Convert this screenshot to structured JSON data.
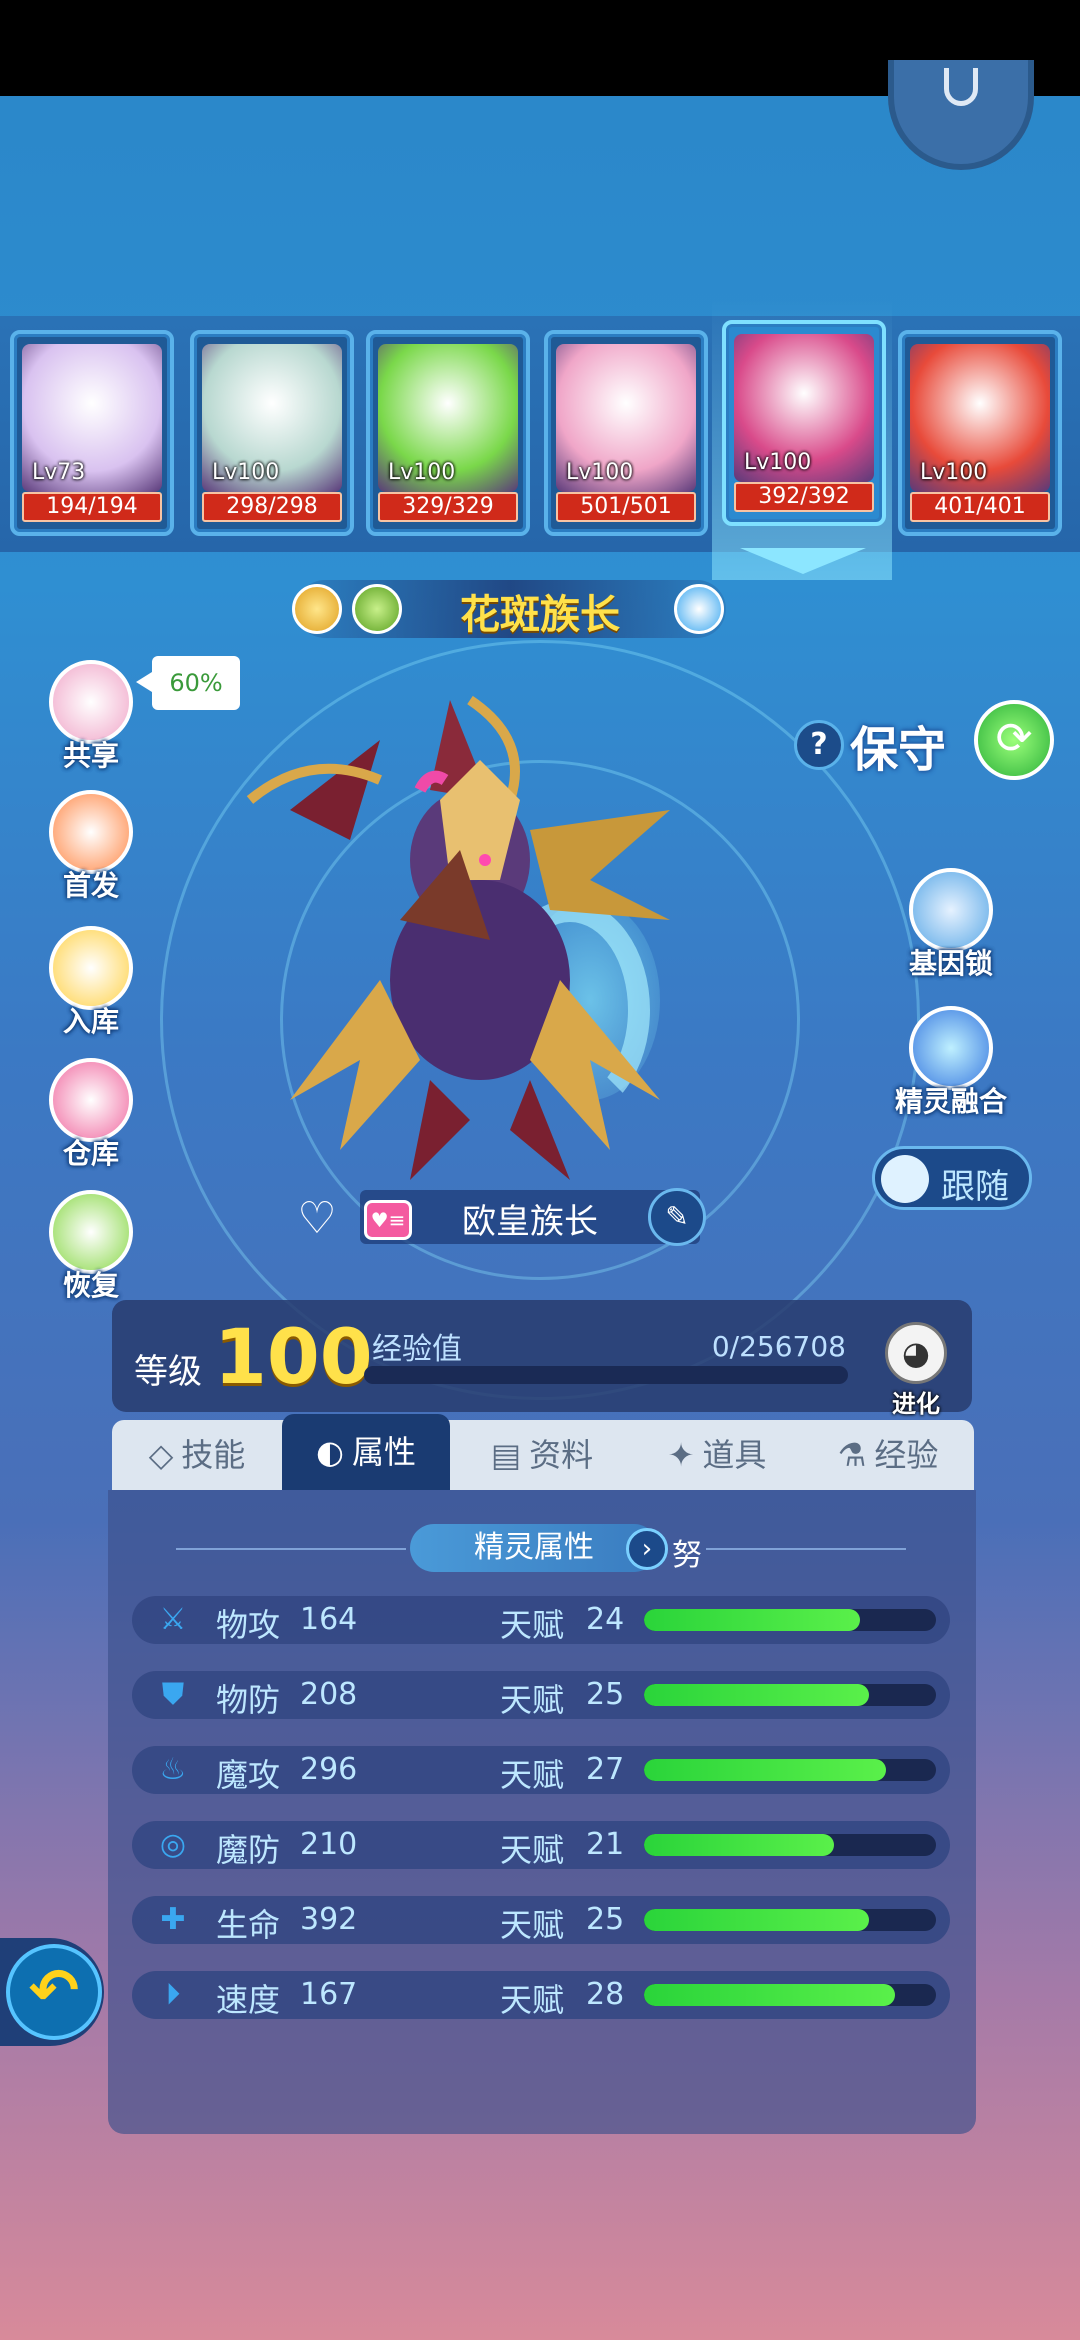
{
  "team": [
    {
      "level": "Lv73",
      "hp": "194/194",
      "color": "#d9c2f0"
    },
    {
      "level": "Lv100",
      "hp": "298/298",
      "color": "#b8d8d0"
    },
    {
      "level": "Lv100",
      "hp": "329/329",
      "color": "#7ad84a"
    },
    {
      "level": "Lv100",
      "hp": "501/501",
      "color": "#f0a6c8"
    },
    {
      "level": "Lv100",
      "hp": "392/392",
      "color": "#d94a8a"
    },
    {
      "level": "Lv100",
      "hp": "401/401",
      "color": "#e84a3a"
    }
  ],
  "title": "花斑族长",
  "exp_share": {
    "label": "共享",
    "percent": "60%",
    "icon": "exp-share-icon"
  },
  "left_menu": [
    {
      "label": "共享",
      "icon": "exp-share-icon"
    },
    {
      "label": "首发",
      "icon": "starter-icon"
    },
    {
      "label": "入库",
      "icon": "store-icon"
    },
    {
      "label": "仓库",
      "icon": "warehouse-icon"
    },
    {
      "label": "恢复",
      "icon": "heal-icon"
    }
  ],
  "right_menu": {
    "guard": "保守",
    "gene_lock": "基因锁",
    "fusion": "精灵融合",
    "follow": "跟随"
  },
  "nickname": "欧皇族长",
  "level": {
    "label": "等级",
    "value": "100",
    "exp_label": "经验值",
    "exp_value": "0/256708",
    "evolve": "进化"
  },
  "tabs": [
    {
      "label": "技能",
      "icon": "skill-icon",
      "active": false
    },
    {
      "label": "属性",
      "icon": "attribute-icon",
      "active": true
    },
    {
      "label": "资料",
      "icon": "profile-icon",
      "active": false
    },
    {
      "label": "道具",
      "icon": "item-icon",
      "active": false
    },
    {
      "label": "经验",
      "icon": "exp-icon",
      "active": false
    }
  ],
  "section": {
    "title": "精灵属性",
    "nature": "努"
  },
  "talent_label": "天赋",
  "stats": [
    {
      "name": "物攻",
      "value": "164",
      "talent": "24",
      "percent": 74,
      "icon": "sword-icon"
    },
    {
      "name": "物防",
      "value": "208",
      "talent": "25",
      "percent": 77,
      "icon": "shield-icon"
    },
    {
      "name": "魔攻",
      "value": "296",
      "talent": "27",
      "percent": 83,
      "icon": "flame-icon"
    },
    {
      "name": "魔防",
      "value": "210",
      "talent": "21",
      "percent": 65,
      "icon": "magic-shield-icon"
    },
    {
      "name": "生命",
      "value": "392",
      "talent": "25",
      "percent": 77,
      "icon": "heart-plus-icon"
    },
    {
      "name": "速度",
      "value": "167",
      "talent": "28",
      "percent": 86,
      "icon": "speed-icon"
    }
  ]
}
